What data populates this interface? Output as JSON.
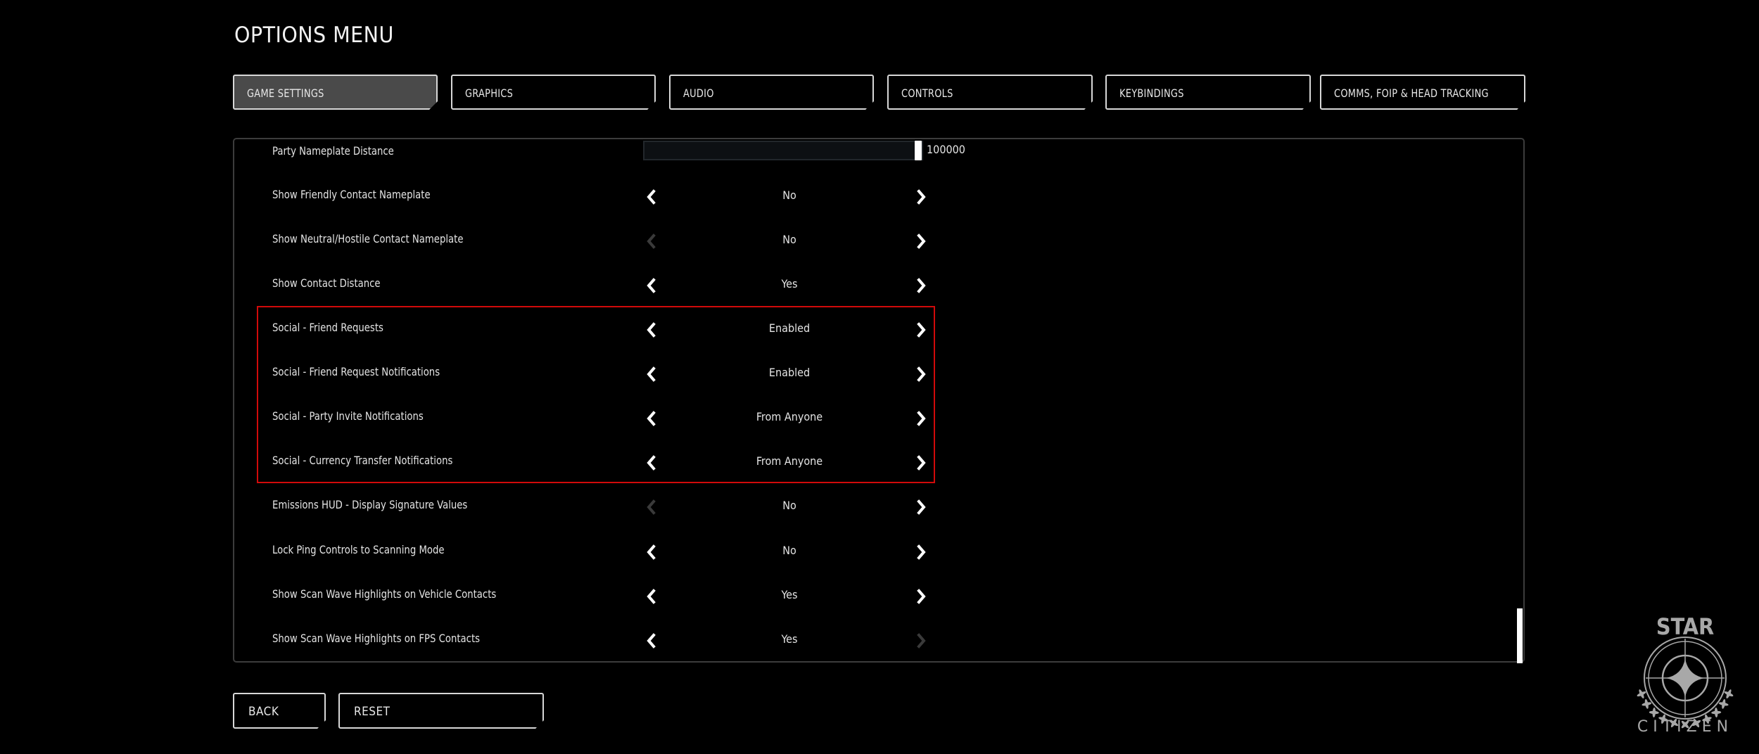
{
  "header": {
    "title": "OPTIONS MENU"
  },
  "tabs": [
    {
      "label": "GAME SETTINGS",
      "active": true
    },
    {
      "label": "GRAPHICS",
      "active": false
    },
    {
      "label": "AUDIO",
      "active": false
    },
    {
      "label": "CONTROLS",
      "active": false
    },
    {
      "label": "KEYBINDINGS",
      "active": false
    },
    {
      "label": "COMMS, FOIP & HEAD TRACKING",
      "active": false
    }
  ],
  "settings": {
    "slider": {
      "label": "Party Nameplate Distance",
      "value": "100000",
      "fill_fraction": 1.0
    },
    "rows": [
      {
        "label": "Show Friendly Contact Nameplate",
        "value": "No",
        "left_enabled": true,
        "right_enabled": true
      },
      {
        "label": "Show Neutral/Hostile Contact Nameplate",
        "value": "No",
        "left_enabled": false,
        "right_enabled": true
      },
      {
        "label": "Show Contact Distance",
        "value": "Yes",
        "left_enabled": true,
        "right_enabled": true
      },
      {
        "label": "Social - Friend Requests",
        "value": "Enabled",
        "left_enabled": true,
        "right_enabled": true
      },
      {
        "label": "Social - Friend Request Notifications",
        "value": "Enabled",
        "left_enabled": true,
        "right_enabled": true
      },
      {
        "label": "Social - Party Invite Notifications",
        "value": "From Anyone",
        "left_enabled": true,
        "right_enabled": true
      },
      {
        "label": "Social - Currency Transfer Notifications",
        "value": "From Anyone",
        "left_enabled": true,
        "right_enabled": true
      },
      {
        "label": "Emissions HUD - Display Signature Values",
        "value": "No",
        "left_enabled": false,
        "right_enabled": true
      },
      {
        "label": "Lock Ping Controls to Scanning Mode",
        "value": "No",
        "left_enabled": true,
        "right_enabled": true
      },
      {
        "label": "Show Scan Wave Highlights on Vehicle Contacts",
        "value": "Yes",
        "left_enabled": true,
        "right_enabled": true
      },
      {
        "label": "Show Scan Wave Highlights on FPS Contacts",
        "value": "Yes",
        "left_enabled": true,
        "right_enabled": false
      }
    ],
    "highlight_color": "#d10a0a",
    "scroll_position": 1.0
  },
  "footer": {
    "back_label": "BACK",
    "reset_label": "RESET"
  },
  "logo": {
    "top_text": "STAR",
    "bottom_text": "CITIZEN"
  },
  "colors": {
    "enabled_arrow": "#ffffff",
    "disabled_arrow": "#3a3a3a",
    "active_tab": "#4a4a4a"
  }
}
